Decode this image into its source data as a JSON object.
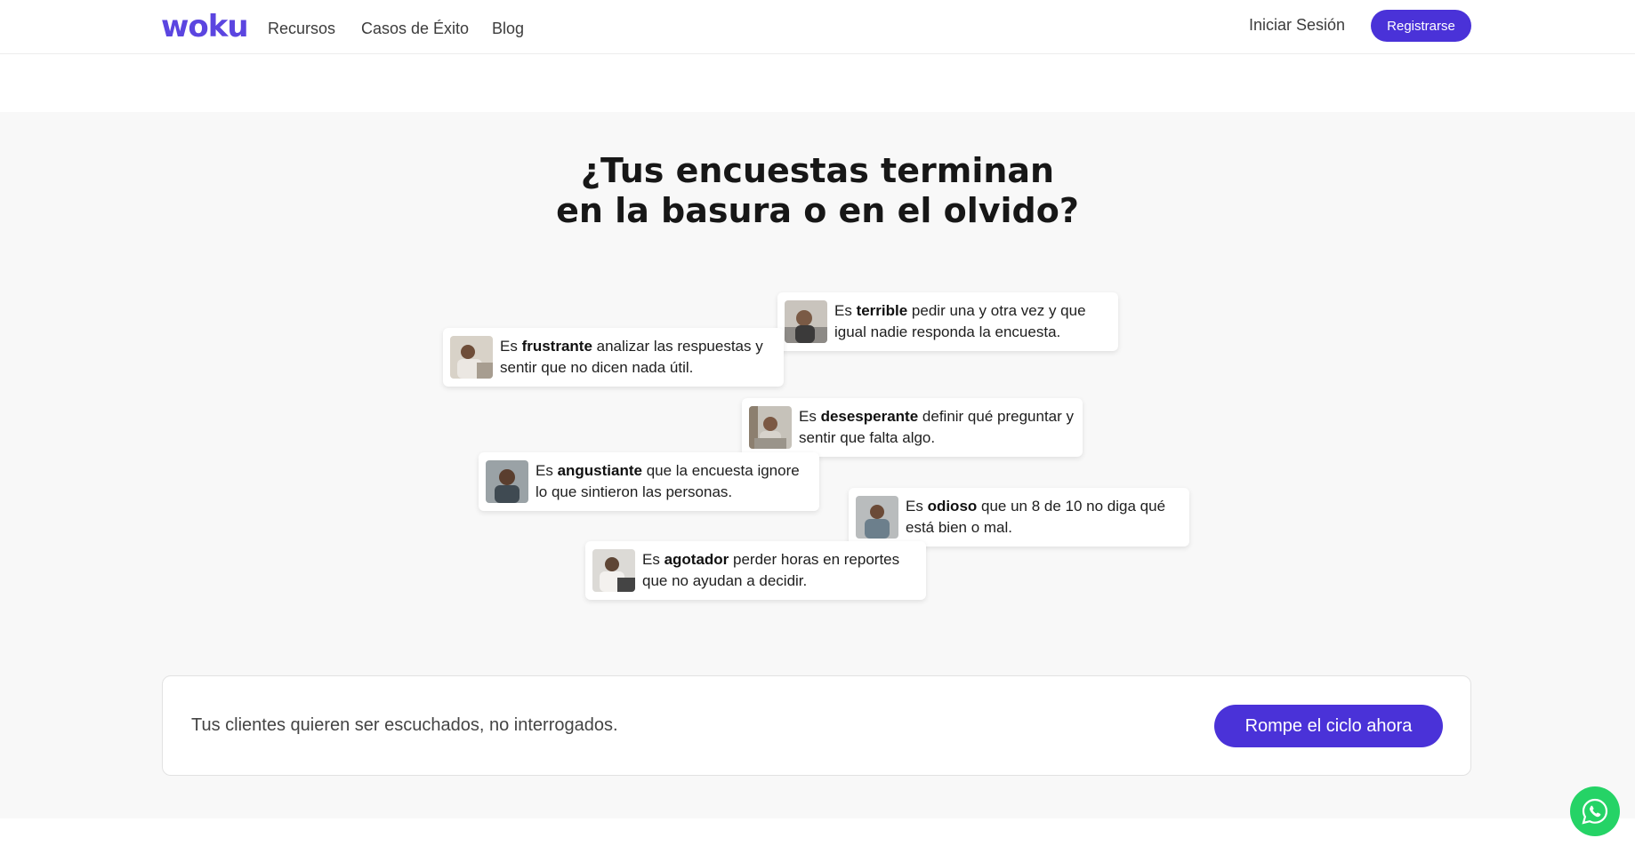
{
  "header": {
    "logo": "woku",
    "nav": [
      "Recursos",
      "Casos de Éxito",
      "Blog"
    ],
    "login": "Iniciar Sesión",
    "register": "Registrarse"
  },
  "hero": {
    "line1": "¿Tus encuestas terminan",
    "line2": "en la basura o en el olvido?"
  },
  "cards": [
    {
      "pre": "Es ",
      "bold": "terrible",
      "rest": " pedir una y otra vez y que igual nadie responda la encuesta."
    },
    {
      "pre": "Es ",
      "bold": "frustrante",
      "rest": " analizar las respuestas y sentir que no dicen nada útil."
    },
    {
      "pre": "Es ",
      "bold": "desesperante",
      "rest": " definir qué preguntar y sentir que falta algo."
    },
    {
      "pre": "Es ",
      "bold": "angustiante",
      "rest": " que la encuesta ignore lo que sintieron las personas."
    },
    {
      "pre": "Es ",
      "bold": "odioso",
      "rest": " que un 8 de 10 no diga qué está bien o mal."
    },
    {
      "pre": "Es ",
      "bold": "agotador",
      "rest": " perder horas en reportes que no ayudan a decidir."
    }
  ],
  "cta": {
    "text": "Tus clientes quieren ser escuchados, no interrogados.",
    "button": "Rompe el ciclo ahora"
  },
  "colors": {
    "brand": "#4a32d8",
    "whatsapp": "#25d366"
  },
  "icons": {
    "whatsapp": "whatsapp-icon"
  }
}
